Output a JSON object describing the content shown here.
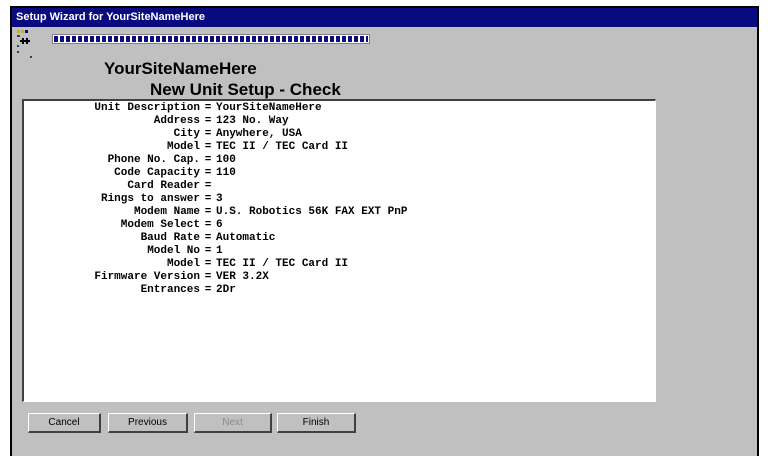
{
  "window": {
    "title": "Setup Wizard for YourSiteNameHere"
  },
  "header": {
    "site_name": "YourSiteNameHere",
    "subtitle": "New Unit Setup - Check",
    "progress": 1.0
  },
  "summary": {
    "rows": [
      {
        "label": "Unit Description",
        "sep": "=",
        "value": "YourSiteNameHere"
      },
      {
        "label": "Address",
        "sep": "=",
        "value": "123 No. Way"
      },
      {
        "label": "City",
        "sep": "=",
        "value": "Anywhere, USA"
      },
      {
        "label": "Model",
        "sep": "=",
        "value": "TEC II / TEC Card II"
      },
      {
        "label": "Phone No. Cap.",
        "sep": "=",
        "value": "100"
      },
      {
        "label": "Code Capacity",
        "sep": "=",
        "value": "110"
      },
      {
        "label": "Card Reader",
        "sep": "=",
        "value": ""
      },
      {
        "label": "Rings to answer",
        "sep": "=",
        "value": "3"
      },
      {
        "label": "Modem Name",
        "sep": "=",
        "value": "U.S. Robotics 56K FAX EXT PnP"
      },
      {
        "label": "Modem Select",
        "sep": "=",
        "value": "6"
      },
      {
        "label": "Baud Rate",
        "sep": "=",
        "value": "Automatic"
      },
      {
        "label": "Model No",
        "sep": "=",
        "value": "1"
      },
      {
        "label": "Model",
        "sep": "=",
        "value": "TEC II / TEC Card II"
      },
      {
        "label": "Firmware Version",
        "sep": "=",
        "value": "VER 3.2X"
      },
      {
        "label": "Entrances",
        "sep": "=",
        "value": "2Dr"
      }
    ]
  },
  "buttons": {
    "cancel": "Cancel",
    "previous": "Previous",
    "next": "Next",
    "finish": "Finish"
  },
  "colors": {
    "titlebar": "#0a0a80",
    "dialog_bg": "#c0c0c0"
  },
  "icons": {
    "logo": "app-logo-icon"
  }
}
